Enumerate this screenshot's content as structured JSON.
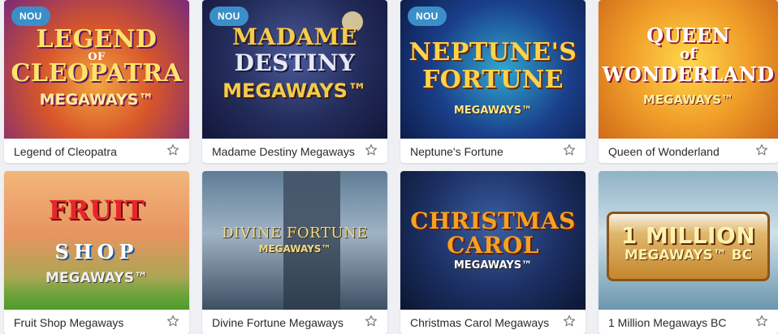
{
  "badge_label": "NOU",
  "accent_color": "#3a8fc9",
  "star_icon": "star-outline-icon",
  "games": [
    {
      "name": "Legend of Cleopatra",
      "badge": true,
      "art": {
        "line1": "LEGEND",
        "line2": "OF",
        "line3": "CLEOPATRA",
        "line4": "MEGAWAYS™"
      }
    },
    {
      "name": "Madame Destiny Megaways",
      "badge": true,
      "art": {
        "line1": "MADAME",
        "line2": "DESTINY",
        "line3": "MEGAWAYS™"
      }
    },
    {
      "name": "Neptune's Fortune",
      "badge": true,
      "art": {
        "line1": "NEPTUNE'S",
        "line2": "FORTUNE",
        "line3": "MEGAWAYS™"
      }
    },
    {
      "name": "Queen of Wonderland",
      "badge": false,
      "art": {
        "line1": "QUEEN",
        "line2": "of",
        "line3": "WONDERLAND",
        "line4": "MEGAWAYS™"
      }
    },
    {
      "name": "Fruit Shop Megaways",
      "badge": false,
      "art": {
        "line1": "FRUIT",
        "line2": "SHOP",
        "line3": "MEGAWAYS™"
      }
    },
    {
      "name": "Divine Fortune Megaways",
      "badge": false,
      "art": {
        "line1": "DIVINE FORTUNE",
        "line2": "MEGAWAYS™"
      }
    },
    {
      "name": "Christmas Carol Megaways",
      "badge": false,
      "art": {
        "line1": "CHRISTMAS",
        "line2": "CAROL",
        "line3": "MEGAWAYS™"
      }
    },
    {
      "name": "1 Million Megaways BC",
      "badge": false,
      "art": {
        "line1": "1 MILLION",
        "line2": "MEGAWAYS™ BC"
      }
    }
  ]
}
